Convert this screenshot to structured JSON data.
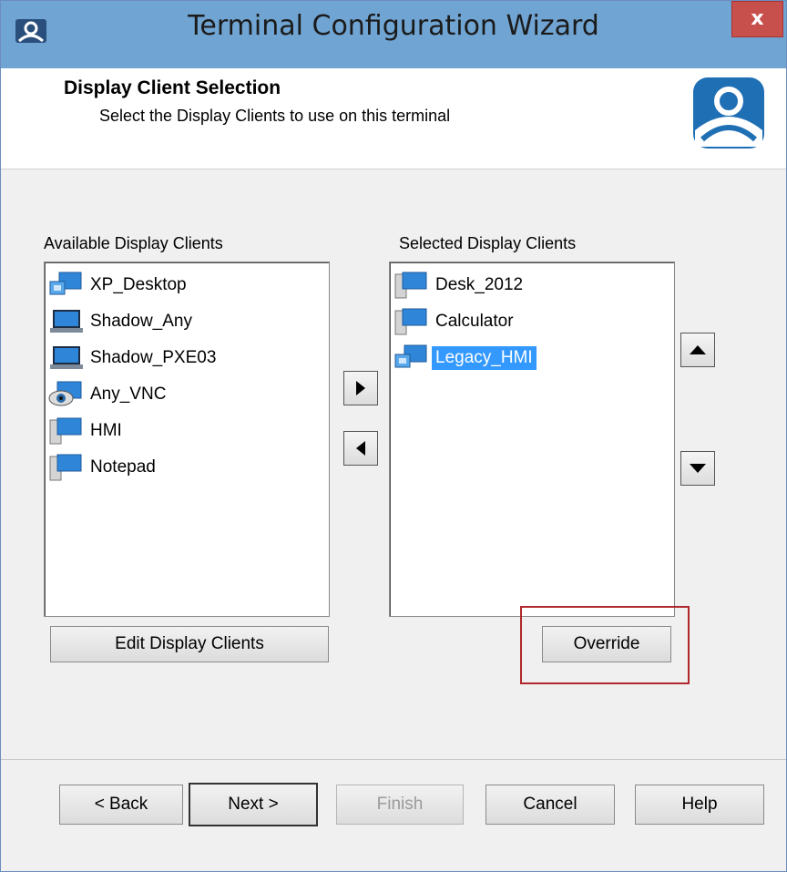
{
  "window": {
    "title": "Terminal Configuration Wizard",
    "close_label": "x"
  },
  "header": {
    "title": "Display Client Selection",
    "subtitle": "Select the Display Clients to use on this terminal"
  },
  "available": {
    "label": "Available Display Clients",
    "items": [
      {
        "label": "XP_Desktop",
        "icon": "multi-monitor-icon"
      },
      {
        "label": "Shadow_Any",
        "icon": "laptop-icon"
      },
      {
        "label": "Shadow_PXE03",
        "icon": "laptop-icon"
      },
      {
        "label": "Any_VNC",
        "icon": "eye-monitor-icon"
      },
      {
        "label": "HMI",
        "icon": "server-monitor-icon"
      },
      {
        "label": "Notepad",
        "icon": "server-monitor-icon"
      }
    ]
  },
  "selected": {
    "label": "Selected Display Clients",
    "items": [
      {
        "label": "Desk_2012",
        "icon": "server-monitor-icon"
      },
      {
        "label": "Calculator",
        "icon": "server-monitor-icon"
      },
      {
        "label": "Legacy_HMI",
        "icon": "multi-monitor-icon",
        "selected": true
      }
    ]
  },
  "buttons": {
    "edit": "Edit Display Clients",
    "override": "Override",
    "back": "< Back",
    "next": "Next >",
    "finish": "Finish",
    "cancel": "Cancel",
    "help": "Help"
  },
  "colors": {
    "titlebar": "#70a4d2",
    "selection": "#3399ff",
    "highlight_box": "#b0282d",
    "close": "#c7504c"
  }
}
